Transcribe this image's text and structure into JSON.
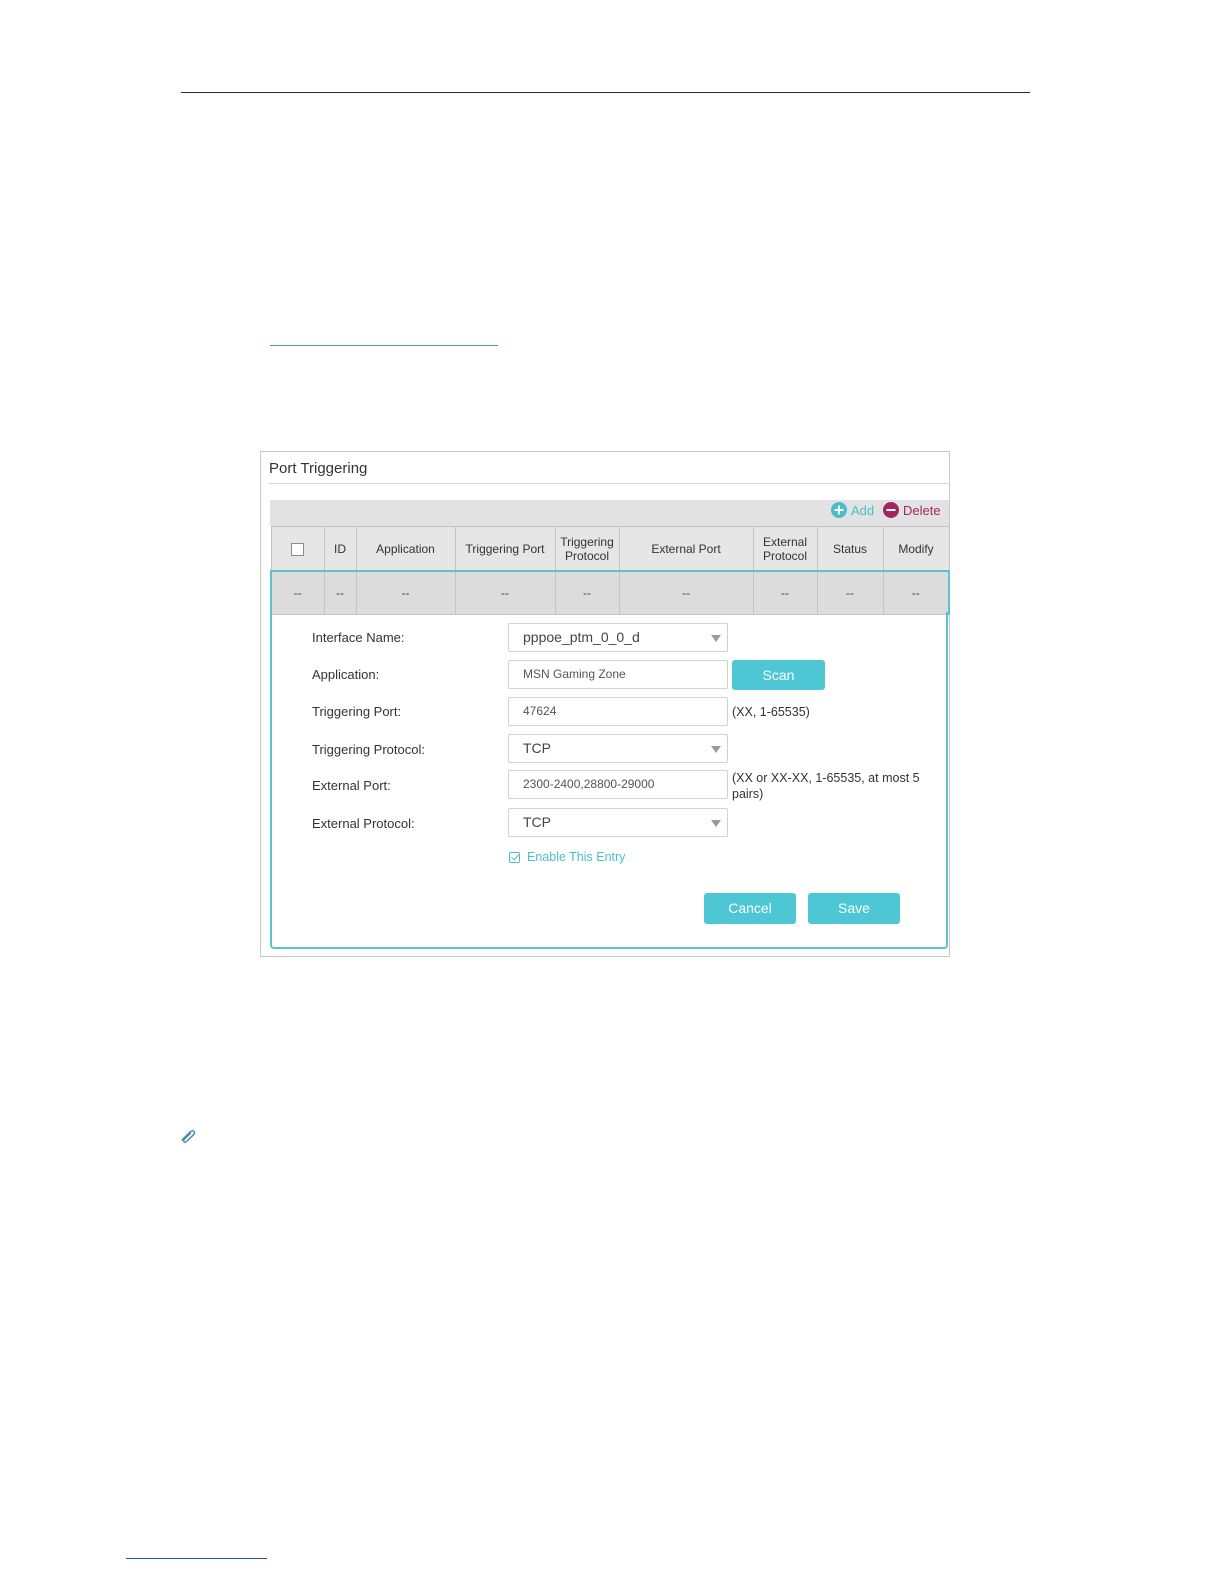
{
  "panel": {
    "title": "Port Triggering"
  },
  "toolbar": {
    "add_label": "Add",
    "delete_label": "Delete",
    "add_icon": "plus-circle-icon",
    "delete_icon": "minus-circle-icon"
  },
  "table": {
    "headers": [
      "",
      "ID",
      "Application",
      "Triggering Port",
      "Triggering Protocol",
      "External Port",
      "External Protocol",
      "Status",
      "Modify"
    ],
    "rows": [
      [
        "--",
        "--",
        "--",
        "--",
        "--",
        "--",
        "--",
        "--",
        "--"
      ]
    ]
  },
  "form": {
    "interface_name": {
      "label": "Interface Name:",
      "value": "pppoe_ptm_0_0_d"
    },
    "application": {
      "label": "Application:",
      "value": "MSN Gaming Zone"
    },
    "triggering_port": {
      "label": "Triggering Port:",
      "value": "47624",
      "hint": "(XX, 1-65535)"
    },
    "triggering_protocol": {
      "label": "Triggering Protocol:",
      "value": "TCP"
    },
    "external_port": {
      "label": "External Port:",
      "value": "2300-2400,28800-29000",
      "hint": "(XX or XX-XX, 1-65535, at most 5 pairs)"
    },
    "external_protocol": {
      "label": "External Protocol:",
      "value": "TCP"
    },
    "enable_label": "Enable This Entry",
    "enable_checked": true,
    "scan_label": "Scan",
    "cancel_label": "Cancel",
    "save_label": "Save"
  },
  "colors": {
    "accent": "#4dc7d3",
    "delete": "#a5265e"
  }
}
